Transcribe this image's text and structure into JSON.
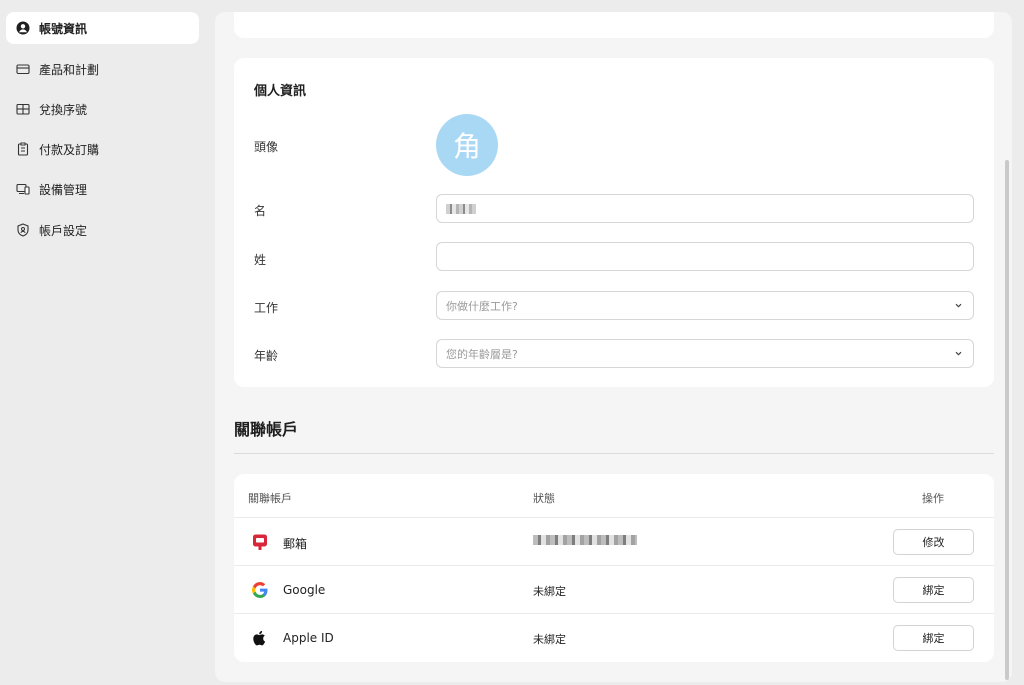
{
  "sidebar": {
    "items": [
      {
        "label": "帳號資訊",
        "icon": "user-circle-icon",
        "active": true
      },
      {
        "label": "產品和計劃",
        "icon": "card-icon",
        "active": false
      },
      {
        "label": "兌換序號",
        "icon": "gift-icon",
        "active": false
      },
      {
        "label": "付款及訂購",
        "icon": "clipboard-icon",
        "active": false
      },
      {
        "label": "設備管理",
        "icon": "devices-icon",
        "active": false
      },
      {
        "label": "帳戶設定",
        "icon": "shield-user-icon",
        "active": false
      }
    ]
  },
  "profile": {
    "section_title": "個人資訊",
    "avatar_label": "頭像",
    "avatar_char": "角",
    "avatar_color": "#a9d8f5",
    "first_name_label": "名",
    "last_name_label": "姓",
    "last_name_value": "",
    "job_label": "工作",
    "job_placeholder": "你做什麼工作?",
    "age_label": "年齡",
    "age_placeholder": "您的年齡層是?"
  },
  "linked": {
    "section_title": "關聯帳戶",
    "columns": {
      "account": "關聯帳戶",
      "status": "狀態",
      "action": "操作"
    },
    "rows": [
      {
        "name": "郵箱",
        "icon": "mail-icon",
        "status": "",
        "action": "修改"
      },
      {
        "name": "Google",
        "icon": "google-icon",
        "status": "未綁定",
        "action": "綁定"
      },
      {
        "name": "Apple ID",
        "icon": "apple-icon",
        "status": "未綁定",
        "action": "綁定"
      }
    ]
  }
}
